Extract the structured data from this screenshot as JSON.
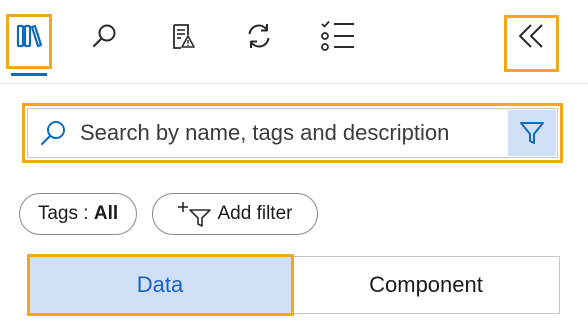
{
  "toolbar": {
    "icons": [
      "library-icon",
      "search-icon",
      "document-warning-icon",
      "refresh-icon",
      "checklist-icon",
      "collapse-icon"
    ]
  },
  "search": {
    "placeholder": "Search by name, tags and description"
  },
  "filters": {
    "tags_label": "Tags : ",
    "tags_value": "All",
    "add_filter_label": "Add filter"
  },
  "segments": {
    "data_label": "Data",
    "component_label": "Component",
    "selected": "Data"
  },
  "colors": {
    "accent": "#0f6cbd",
    "highlight_frame": "#f2a81d",
    "selected_fill": "#cfe0f7"
  }
}
